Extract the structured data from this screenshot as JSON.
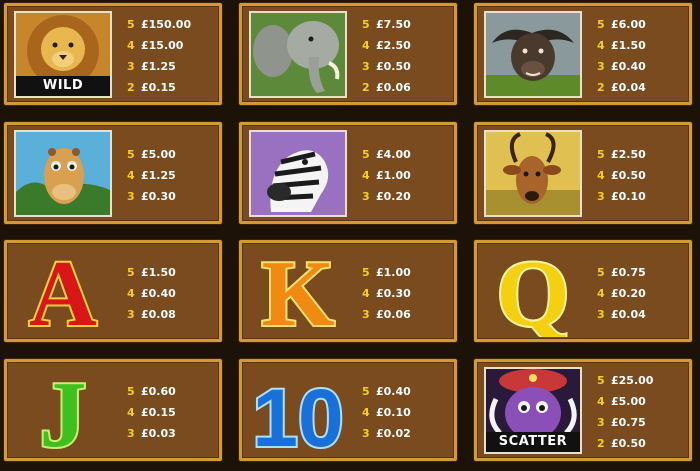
{
  "symbols": [
    {
      "id": "lion",
      "caption": "WILD",
      "pays": [
        {
          "count": "5",
          "amount": "£150.00"
        },
        {
          "count": "4",
          "amount": "£15.00"
        },
        {
          "count": "3",
          "amount": "£1.25"
        },
        {
          "count": "2",
          "amount": "£0.15"
        }
      ]
    },
    {
      "id": "elephant",
      "pays": [
        {
          "count": "5",
          "amount": "£7.50"
        },
        {
          "count": "4",
          "amount": "£2.50"
        },
        {
          "count": "3",
          "amount": "£0.50"
        },
        {
          "count": "2",
          "amount": "£0.06"
        }
      ]
    },
    {
      "id": "buffalo",
      "pays": [
        {
          "count": "5",
          "amount": "£6.00"
        },
        {
          "count": "4",
          "amount": "£1.50"
        },
        {
          "count": "3",
          "amount": "£0.40"
        },
        {
          "count": "2",
          "amount": "£0.04"
        }
      ]
    },
    {
      "id": "giraffe",
      "pays": [
        {
          "count": "5",
          "amount": "£5.00"
        },
        {
          "count": "4",
          "amount": "£1.25"
        },
        {
          "count": "3",
          "amount": "£0.30"
        }
      ]
    },
    {
      "id": "zebra",
      "pays": [
        {
          "count": "5",
          "amount": "£4.00"
        },
        {
          "count": "4",
          "amount": "£1.00"
        },
        {
          "count": "3",
          "amount": "£0.20"
        }
      ]
    },
    {
      "id": "antelope",
      "pays": [
        {
          "count": "5",
          "amount": "£2.50"
        },
        {
          "count": "4",
          "amount": "£0.50"
        },
        {
          "count": "3",
          "amount": "£0.10"
        }
      ]
    },
    {
      "id": "A",
      "letter": "A",
      "pays": [
        {
          "count": "5",
          "amount": "£1.50"
        },
        {
          "count": "4",
          "amount": "£0.40"
        },
        {
          "count": "3",
          "amount": "£0.08"
        }
      ]
    },
    {
      "id": "K",
      "letter": "K",
      "pays": [
        {
          "count": "5",
          "amount": "£1.00"
        },
        {
          "count": "4",
          "amount": "£0.30"
        },
        {
          "count": "3",
          "amount": "£0.06"
        }
      ]
    },
    {
      "id": "Q",
      "letter": "Q",
      "pays": [
        {
          "count": "5",
          "amount": "£0.75"
        },
        {
          "count": "4",
          "amount": "£0.20"
        },
        {
          "count": "3",
          "amount": "£0.04"
        }
      ]
    },
    {
      "id": "J",
      "letter": "J",
      "pays": [
        {
          "count": "5",
          "amount": "£0.60"
        },
        {
          "count": "4",
          "amount": "£0.15"
        },
        {
          "count": "3",
          "amount": "£0.03"
        }
      ]
    },
    {
      "id": "10",
      "letter": "10",
      "pays": [
        {
          "count": "5",
          "amount": "£0.40"
        },
        {
          "count": "4",
          "amount": "£0.10"
        },
        {
          "count": "3",
          "amount": "£0.02"
        }
      ]
    },
    {
      "id": "scatter",
      "caption": "SCATTER",
      "pays": [
        {
          "count": "5",
          "amount": "£25.00"
        },
        {
          "count": "4",
          "amount": "£5.00"
        },
        {
          "count": "3",
          "amount": "£0.75"
        },
        {
          "count": "2",
          "amount": "£0.50"
        }
      ]
    }
  ],
  "colors": {
    "panel": "#7a4b1e",
    "border": "#d29a30",
    "count": "#f4d020",
    "amount": "#ffffff",
    "background": "#1c1208"
  }
}
